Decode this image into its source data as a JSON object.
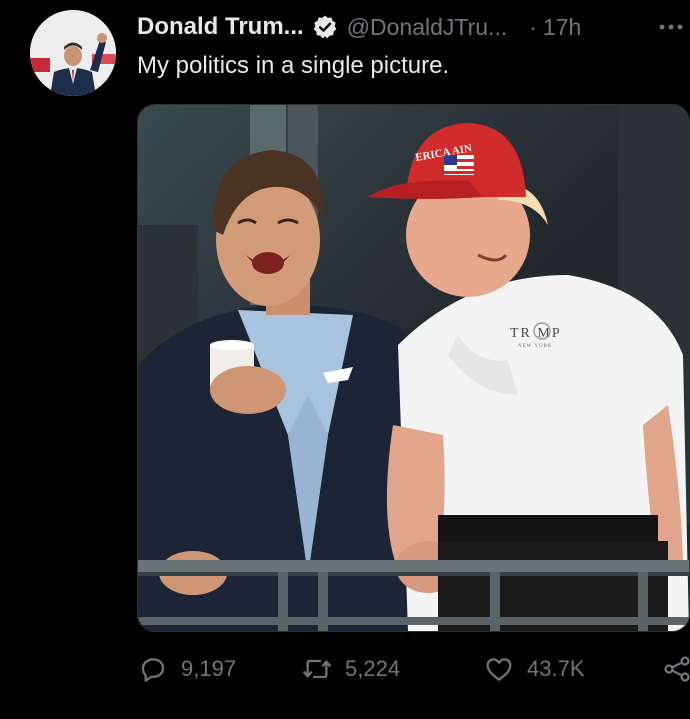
{
  "tweet": {
    "author_name": "Donald Trum...",
    "handle": "@DonaldJTru...",
    "separator": "·",
    "time": "17h",
    "text": "My politics in a single picture."
  },
  "photo": {
    "cap_text": "ERICA AIN",
    "shirt_logo": "TR  MP",
    "shirt_sub": "NEW YORK"
  },
  "actions": {
    "replies": "9,197",
    "retweets": "5,224",
    "likes": "43.7K"
  },
  "icons": [
    "verified-badge-icon",
    "more-icon",
    "reply-icon",
    "retweet-icon",
    "like-icon",
    "share-icon"
  ]
}
